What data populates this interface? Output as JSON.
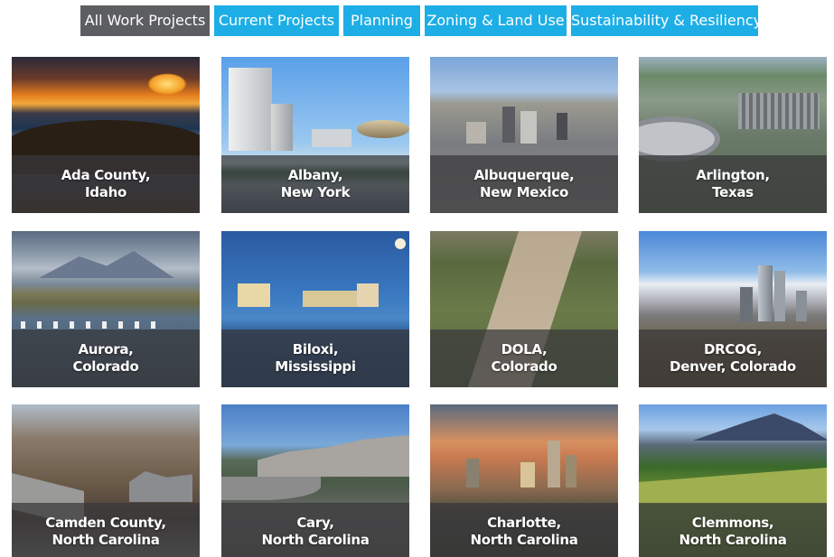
{
  "filters": [
    {
      "label": "All Work Projects",
      "active": true
    },
    {
      "label": "Current Projects",
      "active": false
    },
    {
      "label": "Planning",
      "active": false
    },
    {
      "label": "Zoning & Land Use",
      "active": false
    },
    {
      "label": "Sustainability & Resiliency",
      "active": false
    }
  ],
  "colors": {
    "filter_active": "#5d5e61",
    "filter_inactive": "#1eaee6",
    "caption_overlay": "#37373a"
  },
  "projects": [
    {
      "line1": "Ada County,",
      "line2": "Idaho"
    },
    {
      "line1": "Albany,",
      "line2": "New York"
    },
    {
      "line1": "Albuquerque,",
      "line2": "New Mexico"
    },
    {
      "line1": "Arlington,",
      "line2": "Texas"
    },
    {
      "line1": "Aurora,",
      "line2": "Colorado"
    },
    {
      "line1": "Biloxi,",
      "line2": "Mississippi"
    },
    {
      "line1": "DOLA,",
      "line2": "Colorado"
    },
    {
      "line1": "DRCOG,",
      "line2": "Denver, Colorado"
    },
    {
      "line1": "Camden County,",
      "line2": "North Carolina"
    },
    {
      "line1": "Cary,",
      "line2": "North Carolina"
    },
    {
      "line1": "Charlotte,",
      "line2": "North Carolina"
    },
    {
      "line1": "Clemmons,",
      "line2": "North Carolina"
    }
  ]
}
